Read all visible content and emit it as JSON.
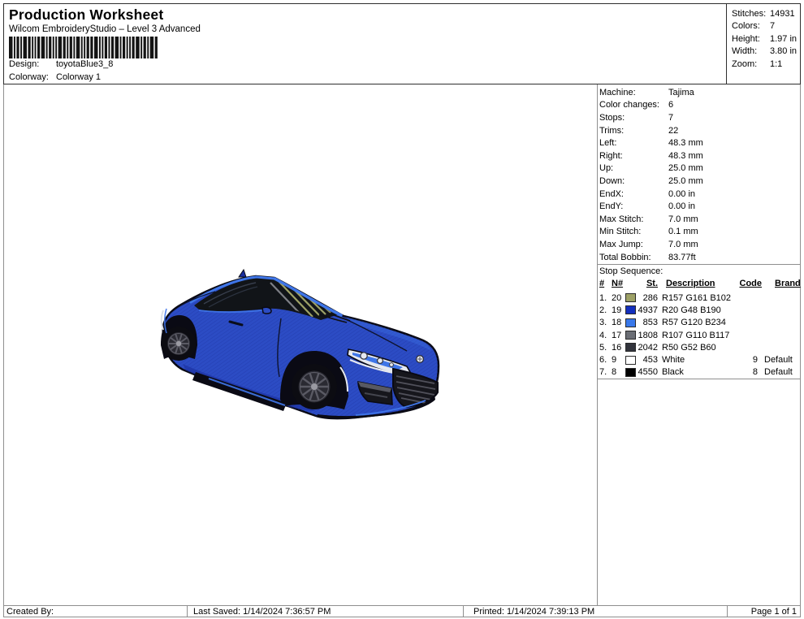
{
  "header": {
    "title": "Production Worksheet",
    "subtitle": "Wilcom EmbroideryStudio – Level 3 Advanced",
    "design_label": "Design:",
    "design_value": "toyotaBlue3_8",
    "colorway_label": "Colorway:",
    "colorway_value": "Colorway 1",
    "stats": [
      {
        "label": "Stitches:",
        "value": "14931"
      },
      {
        "label": "Colors:",
        "value": "7"
      },
      {
        "label": "Height:",
        "value": "1.97 in"
      },
      {
        "label": "Width:",
        "value": "3.80 in"
      },
      {
        "label": "Zoom:",
        "value": "1:1"
      }
    ]
  },
  "machine_info": {
    "rows": [
      {
        "label": "Machine:",
        "value": "Tajima"
      },
      {
        "label": "Color changes:",
        "value": "6"
      },
      {
        "label": "Stops:",
        "value": "7"
      },
      {
        "label": "Trims:",
        "value": "22"
      },
      {
        "label": "Left:",
        "value": "48.3 mm"
      },
      {
        "label": "Right:",
        "value": "48.3 mm"
      },
      {
        "label": "Up:",
        "value": "25.0 mm"
      },
      {
        "label": "Down:",
        "value": "25.0 mm"
      },
      {
        "label": "EndX:",
        "value": "0.00 in"
      },
      {
        "label": "EndY:",
        "value": "0.00 in"
      },
      {
        "label": "Max Stitch:",
        "value": "7.0 mm"
      },
      {
        "label": "Min Stitch:",
        "value": "0.1 mm"
      },
      {
        "label": "Max Jump:",
        "value": "7.0 mm"
      },
      {
        "label": "Total Bobbin:",
        "value": "83.77ft"
      }
    ]
  },
  "stop_sequence": {
    "title": "Stop Sequence:",
    "columns": [
      "#",
      "N#",
      "St.",
      "Description",
      "Code",
      "Brand"
    ],
    "rows": [
      {
        "num": "1.",
        "n": "20",
        "color": "#9da166",
        "st": "286",
        "description": "R157 G161 B102",
        "code": "",
        "brand": ""
      },
      {
        "num": "2.",
        "n": "19",
        "color": "#1430be",
        "st": "4937",
        "description": "R20 G48 B190",
        "code": "",
        "brand": ""
      },
      {
        "num": "3.",
        "n": "18",
        "color": "#3978ea",
        "st": "853",
        "description": "R57 G120 B234",
        "code": "",
        "brand": ""
      },
      {
        "num": "4.",
        "n": "17",
        "color": "#6b6e75",
        "st": "1808",
        "description": "R107 G110 B117",
        "code": "",
        "brand": ""
      },
      {
        "num": "5.",
        "n": "16",
        "color": "#32343c",
        "st": "2042",
        "description": "R50 G52 B60",
        "code": "",
        "brand": ""
      },
      {
        "num": "6.",
        "n": "9",
        "color": "#ffffff",
        "st": "453",
        "description": "White",
        "code": "9",
        "brand": "Default"
      },
      {
        "num": "7.",
        "n": "8",
        "color": "#000000",
        "st": "4550",
        "description": "Black",
        "code": "8",
        "brand": "Default"
      }
    ]
  },
  "footer": {
    "created_by": "Created By:",
    "last_saved": "Last Saved: 1/14/2024 7:36:57 PM",
    "printed": "Printed: 1/14/2024 7:39:13 PM",
    "page": "Page 1 of 1"
  },
  "design_preview": {
    "description": "Blue Toyota coupe embroidery, front three-quarter view",
    "colors": {
      "body": "#2c4cc4",
      "body-dark": "#1b2f9e",
      "accent": "#3f76e8",
      "outline": "#0a0a14",
      "glass": "#111418",
      "reflection": "#9da166",
      "tire": "#0c0c12",
      "rim": "#2a2a32",
      "spoke": "#5a5a64",
      "light": "#e6e9f0",
      "grille": "#16161c"
    }
  }
}
